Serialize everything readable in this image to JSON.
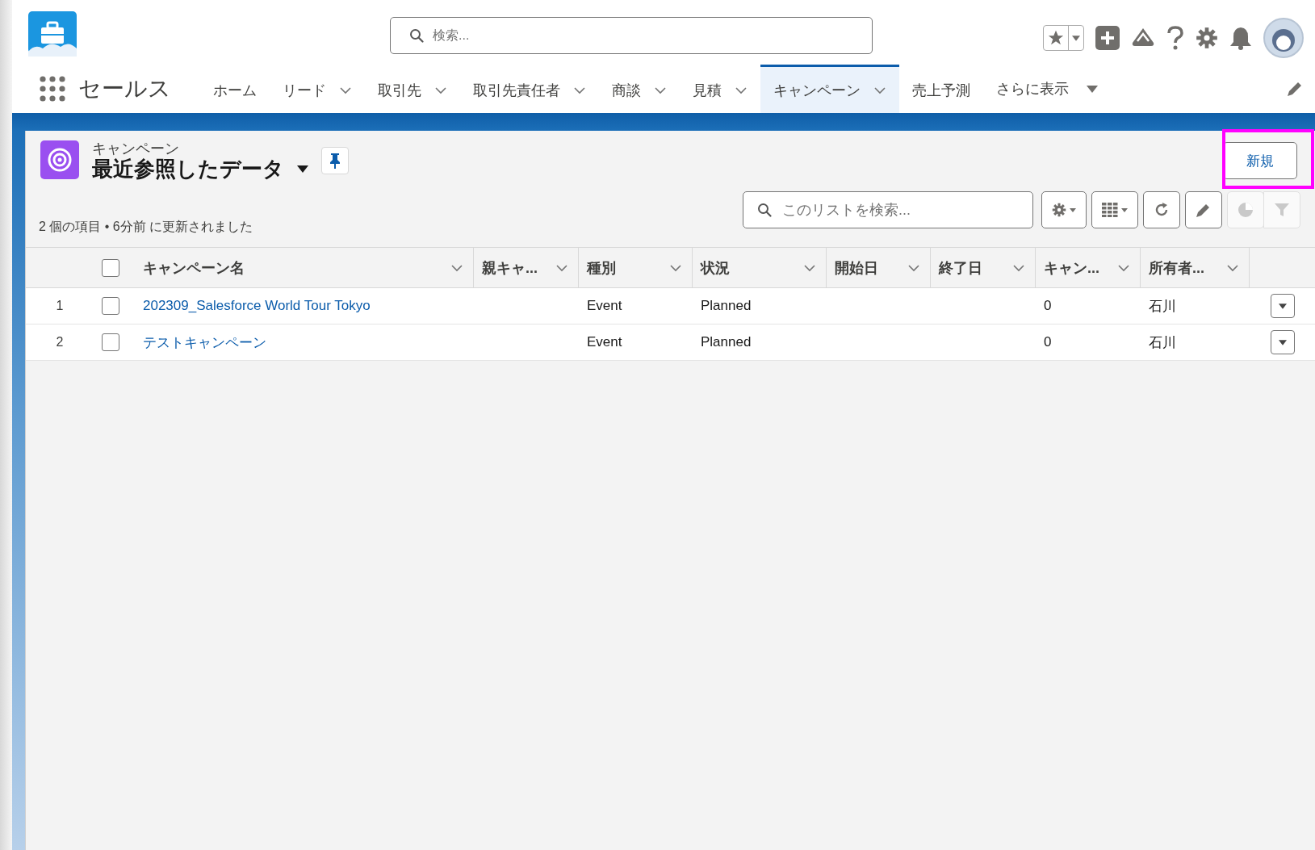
{
  "search": {
    "placeholder": "検索..."
  },
  "app": {
    "name": "セールス"
  },
  "nav": [
    {
      "label": "ホーム",
      "dropdown": false,
      "selected": false
    },
    {
      "label": "リード",
      "dropdown": true,
      "selected": false
    },
    {
      "label": "取引先",
      "dropdown": true,
      "selected": false
    },
    {
      "label": "取引先責任者",
      "dropdown": true,
      "selected": false
    },
    {
      "label": "商談",
      "dropdown": true,
      "selected": false
    },
    {
      "label": "見積",
      "dropdown": true,
      "selected": false
    },
    {
      "label": "キャンペーン",
      "dropdown": true,
      "selected": true
    },
    {
      "label": "売上予測",
      "dropdown": false,
      "selected": false
    }
  ],
  "more": {
    "label": "さらに表示"
  },
  "list": {
    "object": "キャンペーン",
    "view": "最近参照したデータ",
    "meta": "2 個の項目 • 6分前 に更新されました",
    "new_button": {
      "label": "新規",
      "highlighted": true
    },
    "search": {
      "placeholder": "このリストを検索..."
    },
    "tools": [
      {
        "kind": "settings",
        "disabled": false
      },
      {
        "kind": "display",
        "disabled": false
      },
      {
        "kind": "refresh",
        "disabled": false
      },
      {
        "kind": "edit",
        "disabled": false
      },
      {
        "kind": "chart",
        "disabled": true
      },
      {
        "kind": "filter",
        "disabled": true
      }
    ],
    "select_all": {
      "checked": false
    },
    "columns": [
      "キャンペーン名",
      "親キャ...",
      "種別",
      "状況",
      "開始日",
      "終了日",
      "キャン...",
      "所有者..."
    ],
    "rows": [
      {
        "number": "1",
        "checked": false,
        "cells": [
          "202309_Salesforce World Tour Tokyo",
          null,
          "Event",
          "Planned",
          null,
          null,
          "0",
          "石川"
        ]
      },
      {
        "number": "2",
        "checked": false,
        "cells": [
          "テストキャンペーン",
          null,
          "Event",
          "Planned",
          null,
          null,
          "0",
          "石川"
        ]
      }
    ]
  }
}
